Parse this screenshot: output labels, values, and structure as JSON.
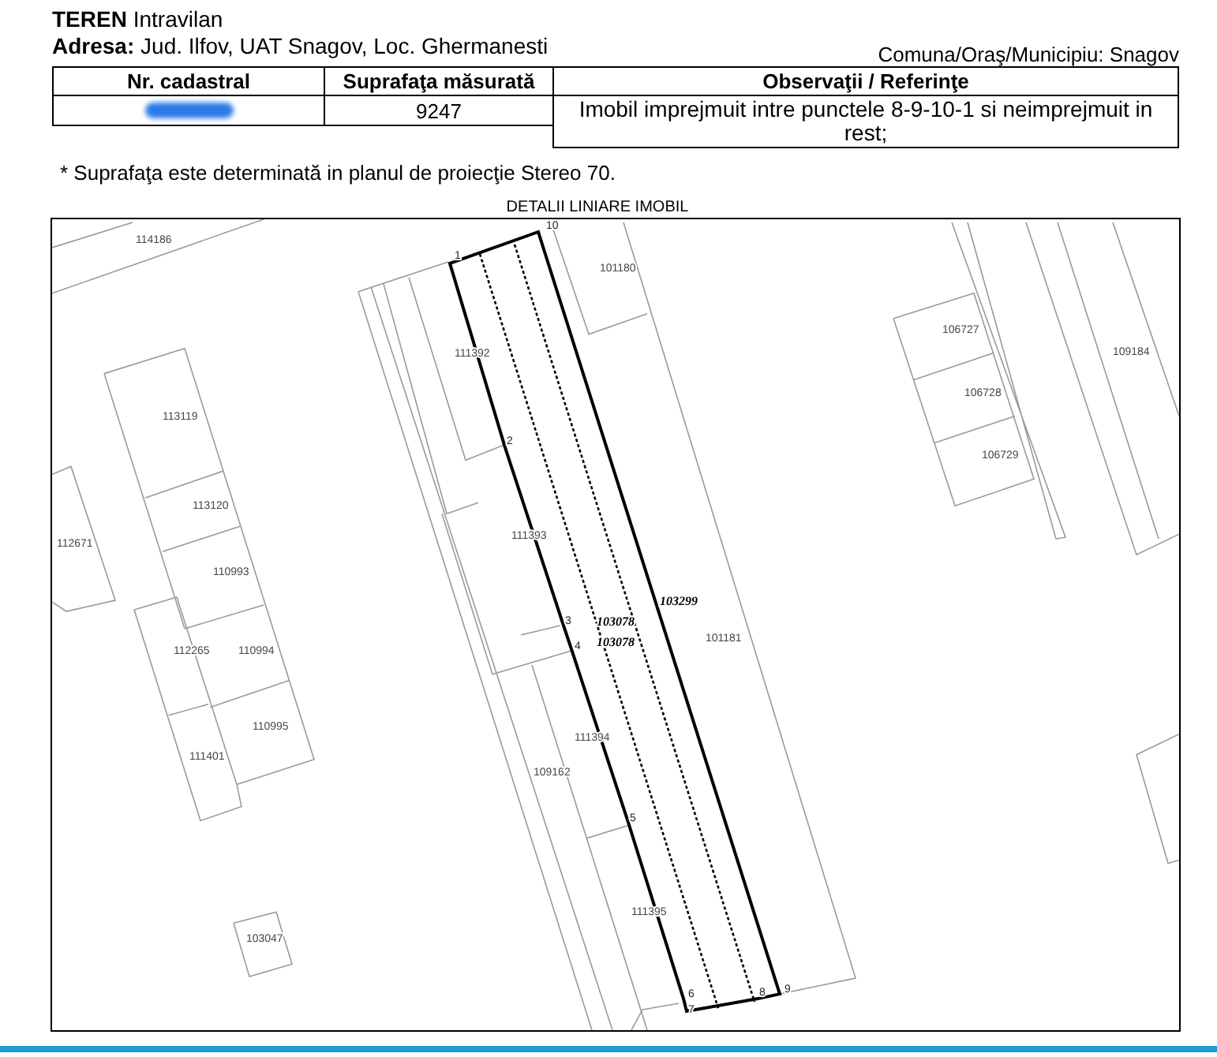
{
  "header": {
    "land_type": "**TEREN** Intravilan",
    "address": "**Adresa:** Jud. Ilfov, UAT Snagov, Loc. Ghermanesti",
    "locality": "Comuna/Oraş/Municipiu: Snagov"
  },
  "table": {
    "columns": [
      "Nr. cadastral",
      "Suprafaţa măsurată",
      "Observaţii / Referinţe"
    ],
    "rows": [
      {
        "cadastral_redacted": true,
        "area": "9247",
        "remarks": "Imobil imprejmuit intre punctele 8-9-10-1 si neimprejmuit in rest;"
      }
    ]
  },
  "footnote": "* Suprafaţa este determinată in planul de proiecţie Stereo 70.",
  "plan": {
    "title": "DETALII LINIARE IMOBIL",
    "parcel_labels": [
      "114186",
      "101180",
      "106727",
      "109184",
      "113119",
      "111392",
      "106728",
      "106729",
      "113120",
      "112671",
      "111393",
      "110993",
      "101181",
      "112265",
      "110994",
      "110995",
      "111394",
      "109162",
      "111401",
      "111395",
      "103047"
    ],
    "property_labels": [
      "103299",
      "103078",
      "103078"
    ],
    "point_labels": [
      "1",
      "10",
      "2",
      "3",
      "4",
      "5",
      "6",
      "7",
      "8",
      "9"
    ]
  }
}
